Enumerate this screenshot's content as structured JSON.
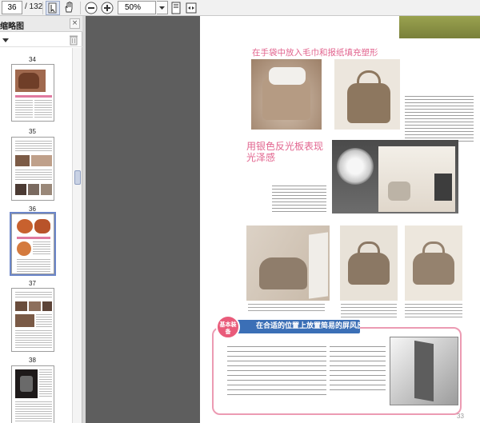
{
  "toolbar": {
    "current_page": "36",
    "page_total": "/ 132",
    "zoom": "50%",
    "icons": [
      "select-text-icon",
      "hand-icon",
      "zoom-out-icon",
      "zoom-in-icon",
      "fit-page-icon",
      "fit-width-icon"
    ]
  },
  "sidebar": {
    "title": "缩略图",
    "close_glyph": "×",
    "thumbnails": [
      {
        "label": "34"
      },
      {
        "label": "35"
      },
      {
        "label": "36"
      },
      {
        "label": "37"
      },
      {
        "label": "38"
      }
    ]
  },
  "page": {
    "heading1": "在手袋中放入毛巾和报纸填充塑形",
    "heading2": "用银色反光板表现光泽感",
    "callout_badge": "基本装备",
    "callout_title": "在合适的位置上放置简易的屏风反光板",
    "page_number": "33"
  },
  "colors": {
    "accent_pink": "#e2658f",
    "callout_blue": "#3b6fb6",
    "viewport_bg": "#5e5e5e",
    "header_olive": "#8b923f"
  }
}
